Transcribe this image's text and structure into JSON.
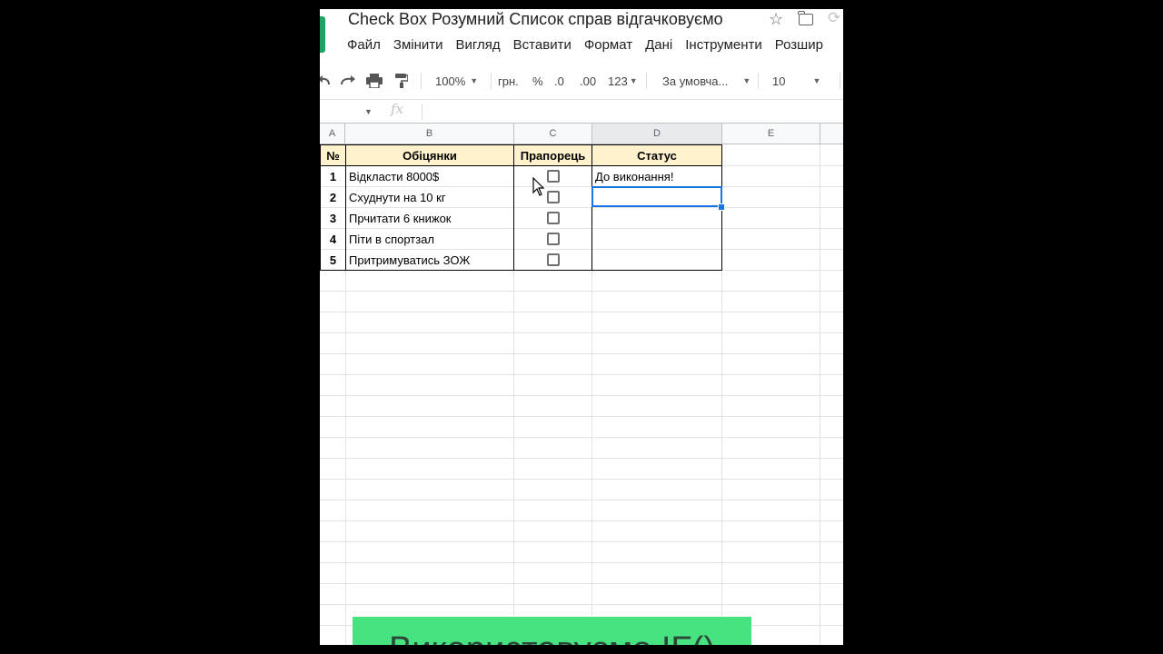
{
  "doc": {
    "title": "Check Box Розумний Список справ відгачковуємо"
  },
  "menu": [
    "Файл",
    "Змінити",
    "Вигляд",
    "Вставити",
    "Формат",
    "Дані",
    "Інструменти",
    "Розшир"
  ],
  "toolbar": {
    "zoom": "100%",
    "currency": "грн.",
    "percent": "%",
    "dec_decrease": ".0",
    "dec_increase": ".00",
    "format_more": "123",
    "font": "За умовча...",
    "font_size": "10"
  },
  "formula_bar": {
    "fx_label": "fx",
    "value": ""
  },
  "columns": [
    "A",
    "B",
    "C",
    "D",
    "E"
  ],
  "table": {
    "headers": {
      "num": "№",
      "promises": "Обіцянки",
      "flag": "Прапорець",
      "status": "Статус"
    },
    "rows": [
      {
        "num": "1",
        "promise": "Відкласти 8000$",
        "checked": false,
        "status": "До виконання!"
      },
      {
        "num": "2",
        "promise": "Схуднути на 10 кг",
        "checked": false,
        "status": ""
      },
      {
        "num": "3",
        "promise": "Прчитати 6 книжок",
        "checked": false,
        "status": ""
      },
      {
        "num": "4",
        "promise": "Піти в спортзал",
        "checked": false,
        "status": ""
      },
      {
        "num": "5",
        "promise": "Притримуватись ЗОЖ",
        "checked": false,
        "status": ""
      }
    ]
  },
  "banner": {
    "text": "Використовуємо IF()",
    "color": "#47e380"
  },
  "colors": {
    "header_fill": "#fff2cc",
    "selection": "#1a73e8",
    "logo": "#1ea362"
  }
}
